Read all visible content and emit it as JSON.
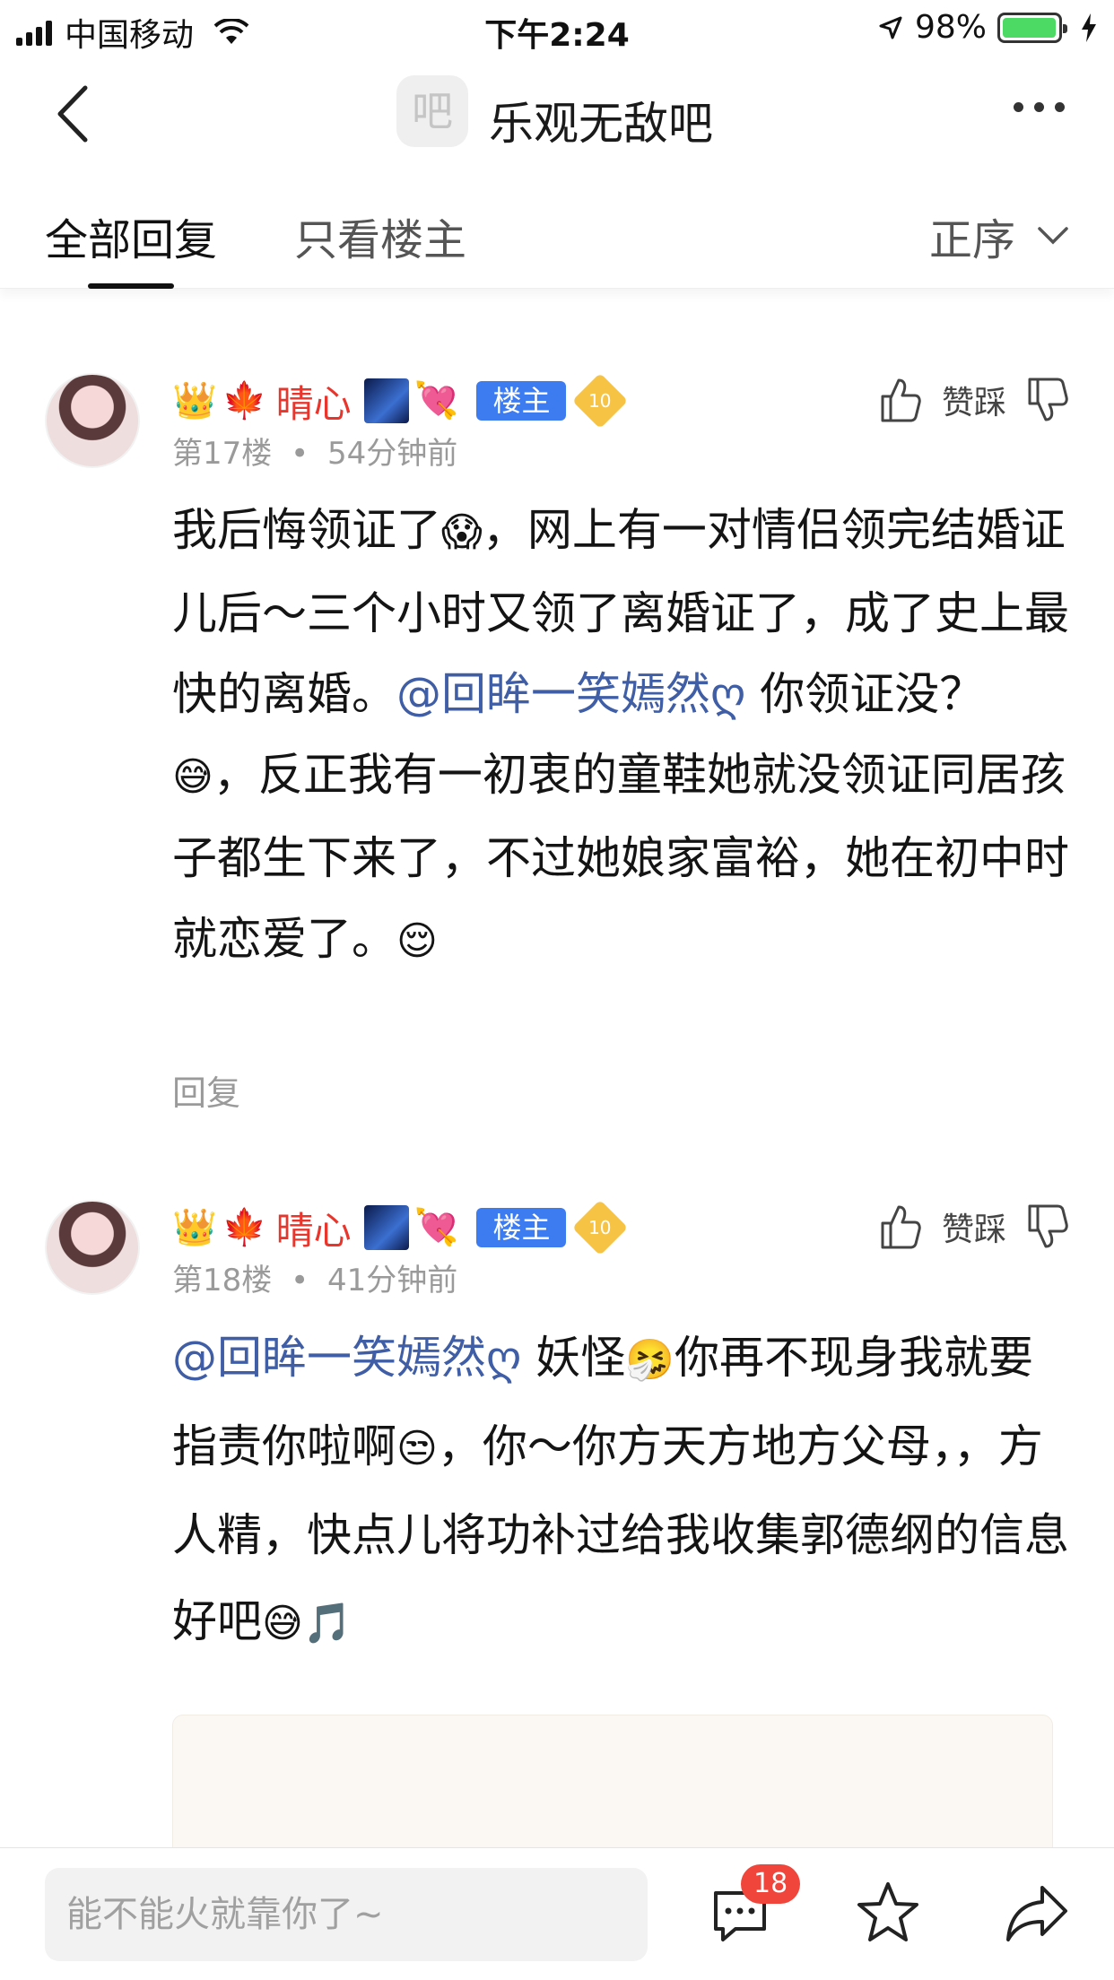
{
  "status_bar": {
    "carrier": "中国移动",
    "time": "下午2:24",
    "battery_percent": "98%",
    "battery_level": 0.98,
    "icons": [
      "signal-icon",
      "wifi-icon",
      "location-icon",
      "battery-icon",
      "charging-icon"
    ]
  },
  "nav": {
    "forum_logo_char": "吧",
    "forum_title": "乐观无敌吧",
    "icons": [
      "back-arrow-icon",
      "more-dots-icon"
    ]
  },
  "tabs": {
    "all_replies": "全部回复",
    "owner_only": "只看楼主",
    "sort_label": "正序",
    "active": "全部回复"
  },
  "posts": [
    {
      "crown": "👑",
      "leaf": "🍁",
      "username": "晴心",
      "heart": "💘",
      "owner_tag": "楼主",
      "level": "10",
      "floor": "第17楼",
      "separator": "•",
      "time": "54分钟前",
      "like_label": "赞踩",
      "text_lines": [
        "我后悔领证了",
        "😱",
        "，网上有一对情侣领完结婚证儿后～三个小时又领了离婚证了，成了史上最快的离婚。",
        "@回眸一笑嫣然ღ",
        " 你领证没？",
        "😅",
        "，反正我有一初衷的童鞋她就没领证同居孩子都生下来了，不过她娘家富裕，她在初中时就恋爱了。",
        "😌"
      ],
      "reply_label": "回复"
    },
    {
      "crown": "👑",
      "leaf": "🍁",
      "username": "晴心",
      "heart": "💘",
      "owner_tag": "楼主",
      "level": "10",
      "floor": "第18楼",
      "separator": "•",
      "time": "41分钟前",
      "like_label": "赞踩",
      "text_lines": [
        "@回眸一笑嫣然ღ",
        " 妖怪",
        "🤧",
        "你再不现身我就要指责你啦啊",
        "😒",
        "，你～你方天方地方父母，，方人精，快点儿将功补过给我收集郭德纲的信息好吧",
        "😅",
        "🎵"
      ]
    }
  ],
  "bottom_bar": {
    "input_placeholder": "能不能火就靠你了~",
    "message_count": "18",
    "icons": [
      "message-icon",
      "star-icon",
      "share-icon"
    ]
  }
}
